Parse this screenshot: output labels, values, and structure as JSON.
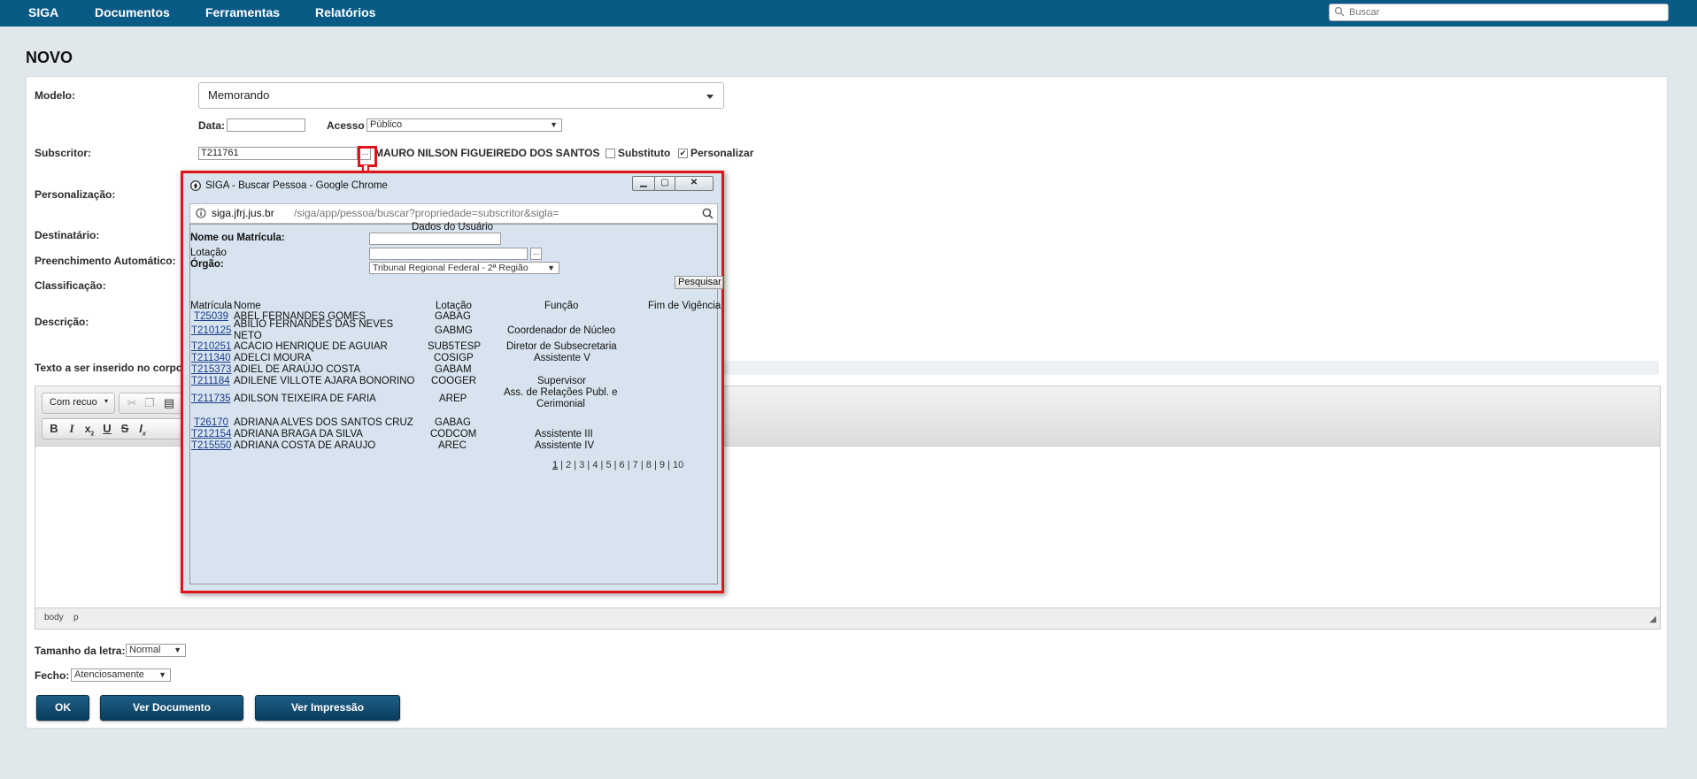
{
  "nav": {
    "brand": "SIGA",
    "items": [
      "Documentos",
      "Ferramentas",
      "Relatórios"
    ],
    "search_placeholder": "Buscar"
  },
  "page": {
    "title": "NOVO"
  },
  "form": {
    "modelo_label": "Modelo:",
    "modelo_value": "Memorando",
    "data_label": "Data:",
    "acesso_label": "Acesso",
    "acesso_value": "Público",
    "subscritor_label": "Subscritor:",
    "subscritor_value": "T211761",
    "subscritor_button": "...",
    "subscritor_name": "MAURO NILSON FIGUEIREDO DOS SANTOS",
    "substituto_label": "Substituto",
    "personalizar_label": "Personalizar",
    "personalizar_checked": true,
    "personalizacao_label": "Personalização:",
    "destinatario_label": "Destinatário:",
    "preenchimento_label": "Preenchimento Automático:",
    "classificacao_label": "Classificação:",
    "descricao_label": "Descrição:",
    "texto_label": "Texto a ser inserido no corpo",
    "tamanho_label": "Tamanho da letra:",
    "tamanho_value": "Normal",
    "fecho_label": "Fecho:",
    "fecho_value": "Atenciosamente"
  },
  "editor": {
    "format_select": "Com recuo",
    "statusbar": [
      "body",
      "p"
    ]
  },
  "buttons": {
    "ok": "OK",
    "ver_documento": "Ver Documento",
    "ver_impressao": "Ver Impressão"
  },
  "popup": {
    "window_title": "SIGA - Buscar Pessoa - Google Chrome",
    "url_host": "siga.jfrj.jus.br",
    "url_path": "/siga/app/pessoa/buscar?propriedade=subscritor&sigla=",
    "section_title": "Dados do Usuário",
    "nome_label": "Nome ou Matrícula:",
    "lotacao_label": "Lotação",
    "lotacao_button": "...",
    "orgao_label": "Órgão:",
    "orgao_value": "Tribunal Regional Federal - 2ª Região",
    "pesquisar_button": "Pesquisar",
    "columns": [
      "Matrícula",
      "Nome",
      "Lotação",
      "Função",
      "Fim de Vigência"
    ],
    "rows": [
      {
        "matricula": "T25039",
        "nome": "ABEL FERNANDES GOMES",
        "lotacao": "GABAG",
        "funcao": ""
      },
      {
        "matricula": "T210125",
        "nome": "ABILIO FERNANDES DAS NEVES",
        "nome2": "NETO",
        "lotacao": "GABMG",
        "funcao": "Coordenador de Núcleo"
      },
      {
        "matricula": "T210251",
        "nome": "ACACIO HENRIQUE DE AGUIAR",
        "lotacao": "SUB5TESP",
        "funcao": "Diretor de Subsecretaria"
      },
      {
        "matricula": "T211340",
        "nome": "ADELCI MOURA",
        "lotacao": "COSIGP",
        "funcao": "Assistente V"
      },
      {
        "matricula": "T215373",
        "nome": "ADIEL DE ARAÚJO COSTA",
        "lotacao": "GABAM",
        "funcao": ""
      },
      {
        "matricula": "T211184",
        "nome": "ADILENE VILLOTE AJARA BONORINO",
        "lotacao": "COOGER",
        "funcao": "Supervisor"
      },
      {
        "matricula": "T211735",
        "nome": "ADILSON TEIXEIRA DE FARIA",
        "lotacao": "AREP",
        "funcao": "Ass. de Relações Publ. e",
        "funcao2": "Cerimonial"
      },
      {
        "matricula": "T26170",
        "nome": "ADRIANA ALVES DOS SANTOS CRUZ",
        "lotacao": "GABAG",
        "funcao": ""
      },
      {
        "matricula": "T212154",
        "nome": "ADRIANA BRAGA DA SILVA",
        "lotacao": "CODCOM",
        "funcao": "Assistente III"
      },
      {
        "matricula": "T215550",
        "nome": "ADRIANA COSTA DE ARAUJO",
        "lotacao": "AREC",
        "funcao": "Assistente IV"
      }
    ],
    "pages": [
      "1",
      "2",
      "3",
      "4",
      "5",
      "6",
      "7",
      "8",
      "9",
      "10"
    ],
    "current_page": "1"
  },
  "colors": {
    "nav_bg": "#0a5a86",
    "highlight": "#e0151b",
    "button_bg": "#0b3e5e"
  }
}
